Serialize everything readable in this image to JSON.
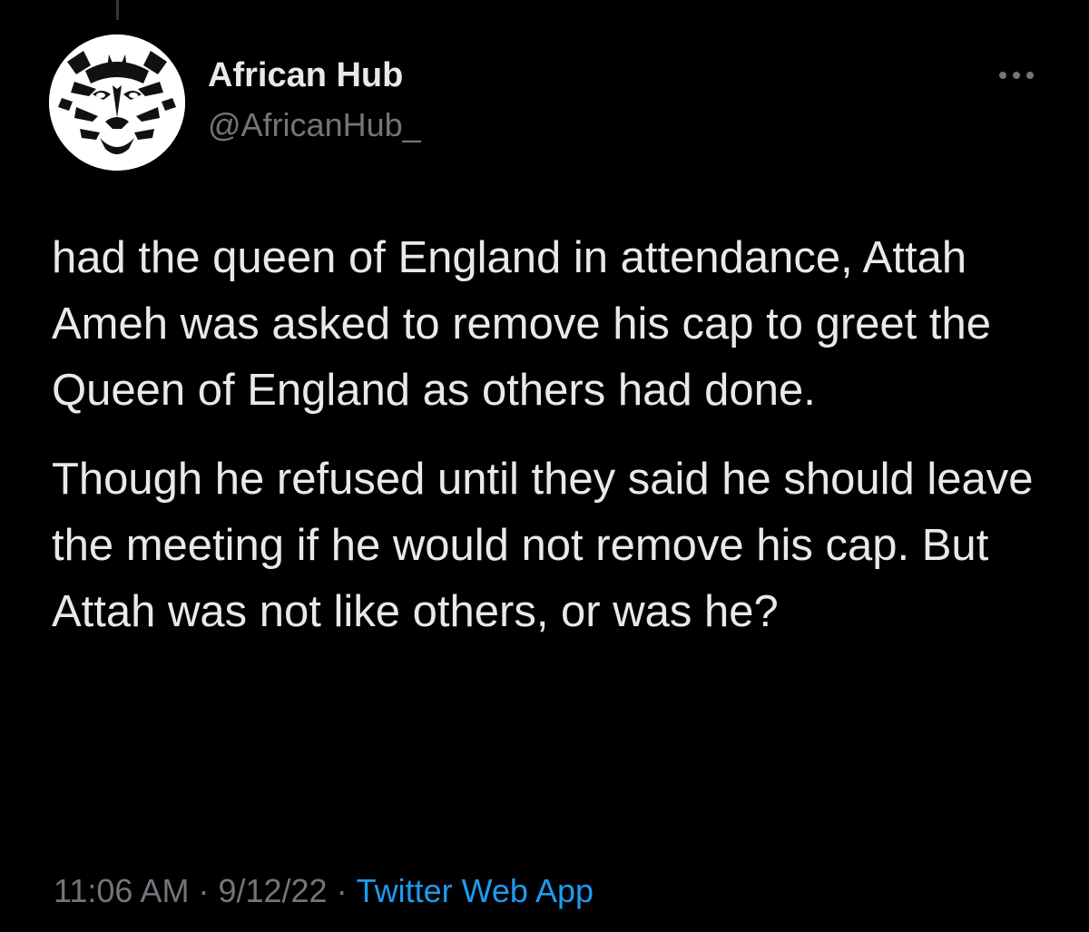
{
  "author": {
    "display_name": "African Hub",
    "handle": "@AfricanHub_",
    "avatar_icon": "tiger-face-icon"
  },
  "more_options_icon": "ellipsis-icon",
  "tweet": {
    "paragraphs": [
      "had the queen of England in attendance, Attah Ameh was asked to remove his cap to greet the Queen of England as others had done.",
      "Though he refused until they said he should leave the meeting if he would not remove his cap. But Attah was not like others, or was he?"
    ]
  },
  "meta": {
    "time": "11:06 AM",
    "separator": "·",
    "date": "9/12/22",
    "source": "Twitter Web App"
  },
  "colors": {
    "background": "#000000",
    "primary_text": "#e7e9ea",
    "secondary_text": "#71767b",
    "link": "#1d9bf0"
  }
}
